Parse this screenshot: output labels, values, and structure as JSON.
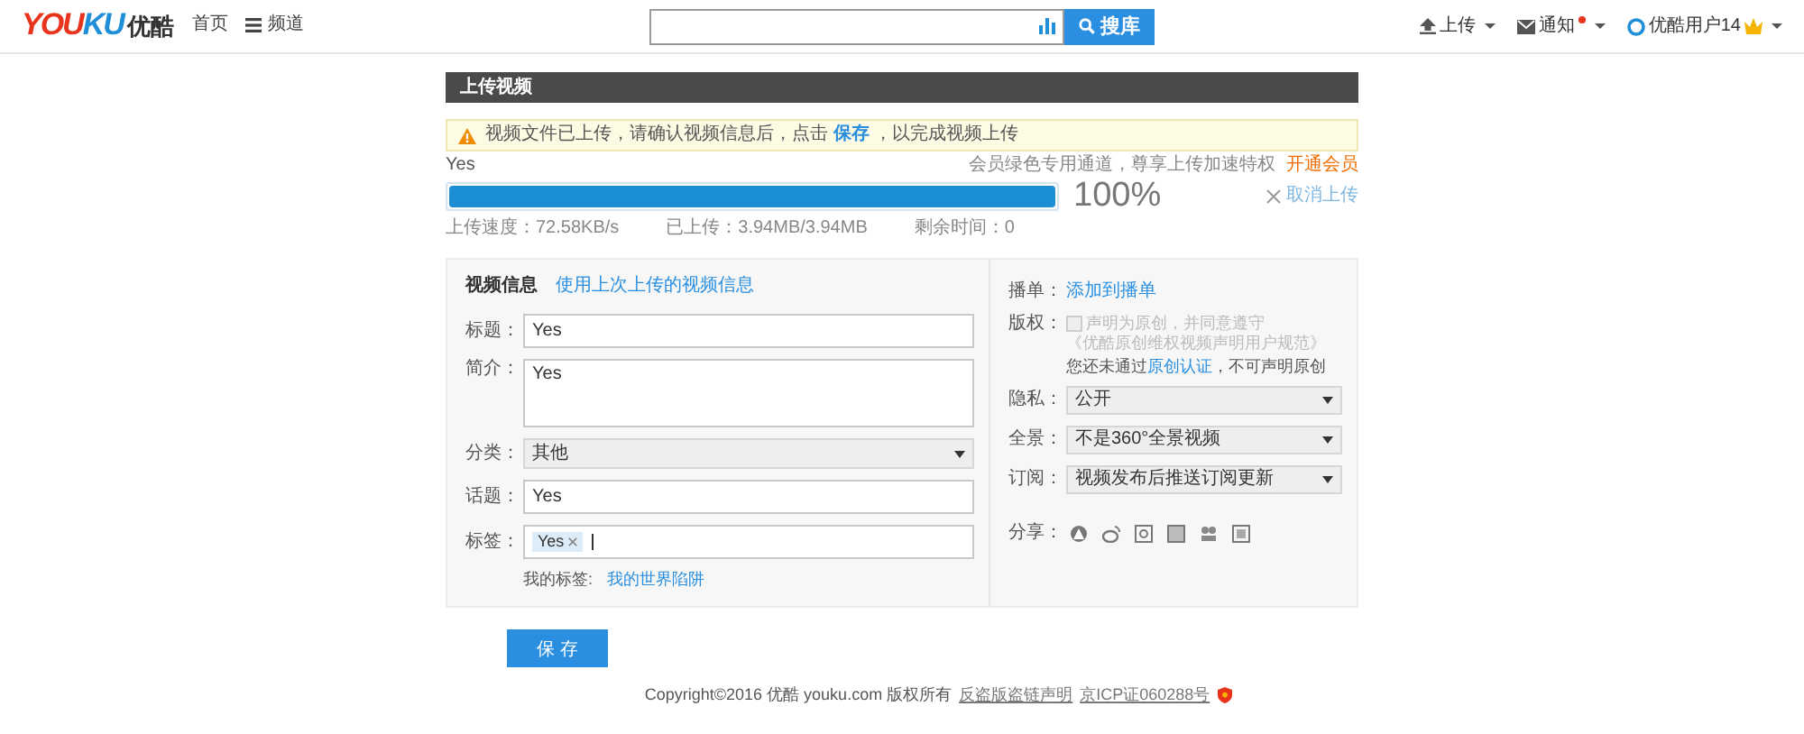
{
  "header": {
    "logo": [
      {
        "text": "YOU",
        "color": "#e8341c"
      },
      {
        "text": "KU",
        "color": "#1e8fd8"
      }
    ],
    "logo_cn": "优酷",
    "nav": [
      {
        "label": "首页",
        "kind": "text"
      },
      {
        "label": "频道",
        "kind": "menu"
      }
    ],
    "search": {
      "button": "搜库"
    },
    "upload": "上传",
    "notify": {
      "label": "通知",
      "unread": true
    },
    "user": "优酷用户14"
  },
  "panel_title": "上传视频",
  "notice": {
    "before": "视频文件已上传，请确认视频信息后，点击",
    "link": "保存",
    "after": "，以完成视频上传"
  },
  "file_name": "Yes",
  "promo": {
    "text": "会员绿色专用通道，尊享上传加速特权",
    "link": "开通会员"
  },
  "progress": {
    "level": 1,
    "percent": "100%",
    "cancel": "取消上传"
  },
  "stats": [
    "上传速度：72.58KB/s",
    "已上传：3.94MB/3.94MB",
    "剩余时间：0"
  ],
  "info": {
    "heading": "视频信息",
    "link": "使用上次上传的视频信息",
    "fields": [
      {
        "kind": "text",
        "label": "标题：",
        "value": "Yes"
      },
      {
        "kind": "textarea",
        "label": "简介：",
        "value": "Yes"
      },
      {
        "kind": "select",
        "label": "分类：",
        "value": "其他"
      },
      {
        "kind": "text",
        "label": "话题：",
        "value": "Yes"
      },
      {
        "kind": "tags",
        "label": "标签：",
        "tags": [
          "Yes"
        ]
      }
    ],
    "my_tags": {
      "label": "我的标签:",
      "link": "我的世界陷阱"
    }
  },
  "side": {
    "playlist": {
      "label": "播单：",
      "link": "添加到播单"
    },
    "copyright": {
      "label": "版权：",
      "checked": false,
      "disabled": true,
      "text": "声明为原创，并同意遵守",
      "rules": "《优酷原创维权视频声明用户规范》",
      "note_before": "您还未通过",
      "note_link": "原创认证",
      "note_after": "，不可声明原创"
    },
    "selects": [
      {
        "label": "隐私：",
        "value": "公开"
      },
      {
        "label": "全景：",
        "value": "不是360°全景视频"
      },
      {
        "label": "订阅：",
        "value": "视频发布后推送订阅更新"
      }
    ],
    "share": "分享："
  },
  "save_button": "保 存",
  "footer": {
    "text": "Copyright©2016 优酷 youku.com 版权所有",
    "links": [
      "反盗版盗链声明",
      "京ICP证060288号"
    ]
  }
}
